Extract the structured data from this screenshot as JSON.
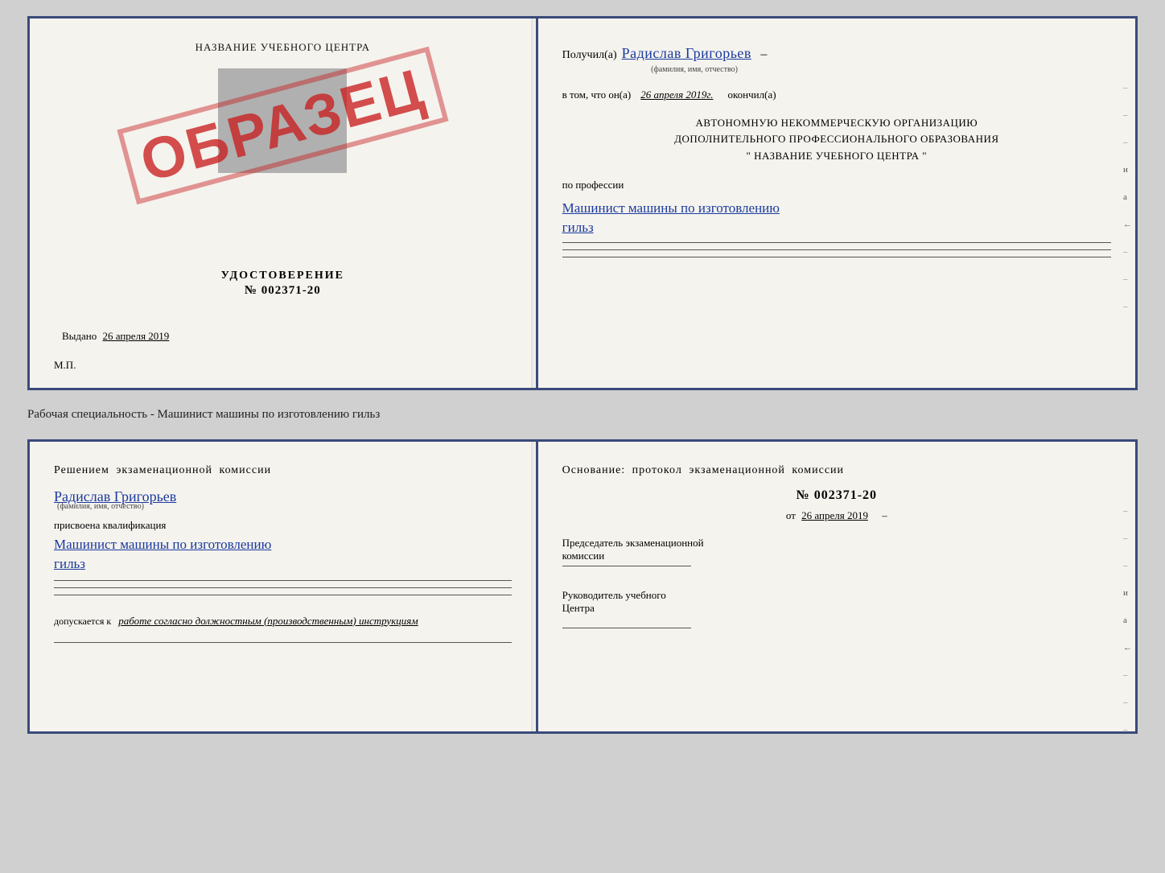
{
  "top_cert": {
    "left": {
      "title": "НАЗВАНИЕ УЧЕБНОГО ЦЕНТРА",
      "gray_box": true,
      "stamp_label": "УДОСТОВЕРЕНИЕ",
      "stamp_number": "№ 002371-20",
      "vydano_prefix": "Выдано",
      "vydano_date": "26 апреля 2019",
      "mp_label": "М.П.",
      "obrazec": "ОБРАЗЕЦ"
    },
    "right": {
      "poluchil_prefix": "Получил(а)",
      "poluchil_name": "Радислав Григорьев",
      "fio_hint": "(фамилия, имя, отчество)",
      "dash": "–",
      "vtom_prefix": "в том, что он(а)",
      "vtom_date": "26 апреля 2019г.",
      "okonchill": "окончил(а)",
      "org_line1": "АВТОНОМНУЮ НЕКОММЕРЧЕСКУЮ ОРГАНИЗАЦИЮ",
      "org_line2": "ДОПОЛНИТЕЛЬНОГО ПРОФЕССИОНАЛЬНОГО ОБРАЗОВАНИЯ",
      "org_quote1": "\"",
      "org_center": "НАЗВАНИЕ УЧЕБНОГО ЦЕНТРА",
      "org_quote2": "\"",
      "po_professii": "по профессии",
      "prof_line1": "Машинист машины по изготовлению",
      "prof_line2": "гильз",
      "dash2": "–",
      "side_marks": [
        "–",
        "–",
        "–",
        "и",
        "а",
        "←",
        "–",
        "–",
        "–"
      ]
    }
  },
  "separator": "Рабочая специальность - Машинист машины по изготовлению гильз",
  "bottom_cert": {
    "left": {
      "resheniye": "Решением  экзаменационной  комиссии",
      "person_name": "Радислав Григорьев",
      "fio_hint": "(фамилия, имя, отчество)",
      "prisvoena": "присвоена квалификация",
      "kvalif_line1": "Машинист машины по изготовлению",
      "kvalif_line2": "гильз",
      "dopusk_prefix": "допускается к",
      "dopusk_text": "работе согласно должностным (производственным) инструкциям"
    },
    "right": {
      "osnov_title": "Основание:  протокол  экзаменационной  комиссии",
      "proto_number": "№  002371-20",
      "proto_date_prefix": "от",
      "proto_date": "26 апреля 2019",
      "predsedatel_line1": "Председатель экзаменационной",
      "predsedatel_line2": "комиссии",
      "rukovoditel_line1": "Руководитель учебного",
      "rukovoditel_line2": "Центра",
      "side_marks": [
        "–",
        "–",
        "–",
        "и",
        "а",
        "←",
        "–",
        "–",
        "–"
      ]
    }
  }
}
